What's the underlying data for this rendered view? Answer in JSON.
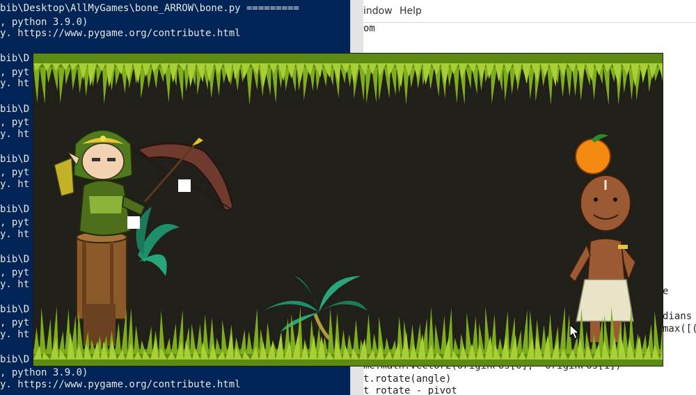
{
  "terminal": {
    "lines": [
      "bib\\Desktop\\AllMyGames\\bone_ARROW\\bone.py =========",
      ", python 3.9.0)",
      "y. https://www.pygame.org/contribute.html",
      "bib\\D",
      ", pyt",
      "y. ht",
      "bib\\D",
      ", pyt",
      "y. ht",
      "bib\\D",
      ", pyt",
      "y. ht",
      "bib\\D",
      ", pyt",
      "y. ht",
      "bib\\D",
      ", pyt",
      "y. ht",
      "bib\\D",
      ", pyt",
      "y. ht",
      "bib\\D",
      ", python 3.9.0)",
      "y. https://www.pygame.org/contribute.html"
    ]
  },
  "editor": {
    "menu": {
      "window": "indow",
      "help": "Help"
    },
    "code_top": "om",
    "code_right_1": "e",
    "code_right_2": "dians",
    "code_right_3": "max([(",
    "code_bottom_1": "me.math.Vector2(originPos[0], -originPos[1])",
    "code_bottom_2": "t.rotate(angle)",
    "code_bottom_3": "t_rotate - pivot"
  },
  "game": {
    "colors": {
      "background": "#211f1a",
      "grass_dark": "#5c8a12",
      "grass_light": "#9cc72a",
      "stump": "#8a5a2b",
      "palm": "#1e8f6a",
      "bow": "#6e3b2e",
      "orange": "#f58a12"
    },
    "sprites": [
      "archer",
      "bow",
      "arrow",
      "tree-stump",
      "palm-plant",
      "target-man",
      "orange"
    ]
  },
  "cursor": {
    "icon": "mouse-pointer-icon"
  }
}
